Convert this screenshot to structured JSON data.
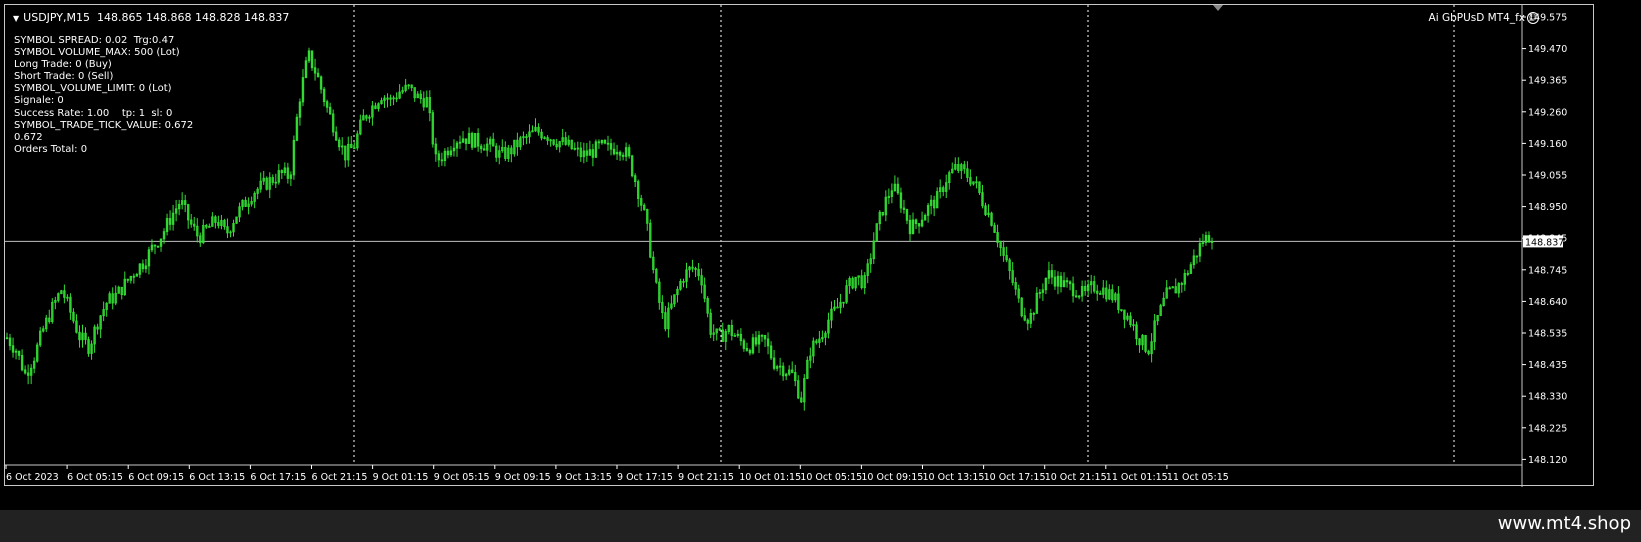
{
  "window": {
    "symbol_line": "USDJPY,M15  148.865 148.868 148.828 148.837",
    "ea_label": "Ai GbPUsD MT4_fx",
    "watermark": "www.mt4.shop"
  },
  "info_panel": [
    "SYMBOL SPREAD: 0.02  Trg:0.47",
    "SYMBOL VOLUME_MAX: 500 (Lot)",
    "Long Trade: 0 (Buy)",
    "Short Trade: 0 (Sell)",
    "SYMBOL_VOLUME_LIMIT: 0 (Lot)",
    "Signale: 0",
    "Success Rate: 1.00    tp: 1  sl: 0",
    "SYMBOL_TRADE_TICK_VALUE: 0.672",
    "0.672",
    "Orders Total: 0"
  ],
  "colors": {
    "background": "#000000",
    "candle": "#33dd33",
    "grid": "#ffffff",
    "price_line": "#c0c0c0"
  },
  "chart_data": {
    "type": "candlestick",
    "symbol": "USDJPY",
    "timeframe": "M15",
    "current_price": 148.837,
    "current_price_label": "148.837",
    "ylim": [
      148.09,
      149.615
    ],
    "y_ticks": [
      "149.575",
      "149.470",
      "149.365",
      "149.260",
      "149.160",
      "149.055",
      "148.950",
      "148.845",
      "148.745",
      "148.640",
      "148.535",
      "148.435",
      "148.330",
      "148.225",
      "148.120"
    ],
    "x_ticks": [
      "6 Oct 2023",
      "6 Oct 05:15",
      "6 Oct 09:15",
      "6 Oct 13:15",
      "6 Oct 17:15",
      "6 Oct 21:15",
      "9 Oct 01:15",
      "9 Oct 05:15",
      "9 Oct 09:15",
      "9 Oct 13:15",
      "9 Oct 17:15",
      "9 Oct 21:15",
      "10 Oct 01:15",
      "10 Oct 05:15",
      "10 Oct 09:15",
      "10 Oct 13:15",
      "10 Oct 17:15",
      "10 Oct 21:15",
      "11 Oct 01:15",
      "11 Oct 05:15"
    ],
    "day_separators": [
      "9 Oct",
      "10 Oct",
      "11 Oct",
      "12 Oct"
    ],
    "close_path": [
      148.52,
      148.48,
      148.4,
      148.46,
      148.55,
      148.62,
      148.68,
      148.6,
      148.52,
      148.49,
      148.58,
      148.64,
      148.66,
      148.7,
      148.74,
      148.77,
      148.82,
      148.86,
      148.92,
      148.97,
      148.9,
      148.85,
      148.88,
      148.91,
      148.86,
      148.92,
      148.96,
      149.0,
      149.02,
      149.04,
      149.06,
      149.05,
      149.3,
      149.45,
      149.38,
      149.28,
      149.2,
      149.12,
      149.15,
      149.24,
      149.28,
      149.32,
      149.3,
      149.33,
      149.34,
      149.31,
      149.3,
      149.1,
      149.13,
      149.17,
      149.18,
      149.17,
      149.16,
      149.15,
      149.12,
      149.13,
      149.16,
      149.18,
      149.2,
      149.19,
      149.17,
      149.16,
      149.14,
      149.12,
      149.13,
      149.15,
      149.14,
      149.15,
      149.12,
      149.02,
      148.9,
      148.7,
      148.56,
      148.64,
      148.72,
      148.75,
      148.73,
      148.55,
      148.52,
      148.55,
      148.52,
      148.49,
      148.5,
      148.51,
      148.44,
      148.42,
      148.4,
      148.32,
      148.48,
      148.52,
      148.58,
      148.62,
      148.68,
      148.72,
      148.7,
      148.85,
      148.95,
      149.02,
      148.96,
      148.88,
      148.91,
      148.95,
      148.98,
      149.05,
      149.08,
      149.06,
      149.03,
      148.96,
      148.9,
      148.8,
      148.72,
      148.62,
      148.58,
      148.66,
      148.73,
      148.71,
      148.69,
      148.68,
      148.66,
      148.69,
      148.68,
      148.66,
      148.62,
      148.58,
      148.52,
      148.48,
      148.58,
      148.66,
      148.68,
      148.72,
      148.78,
      148.84,
      148.86
    ]
  }
}
